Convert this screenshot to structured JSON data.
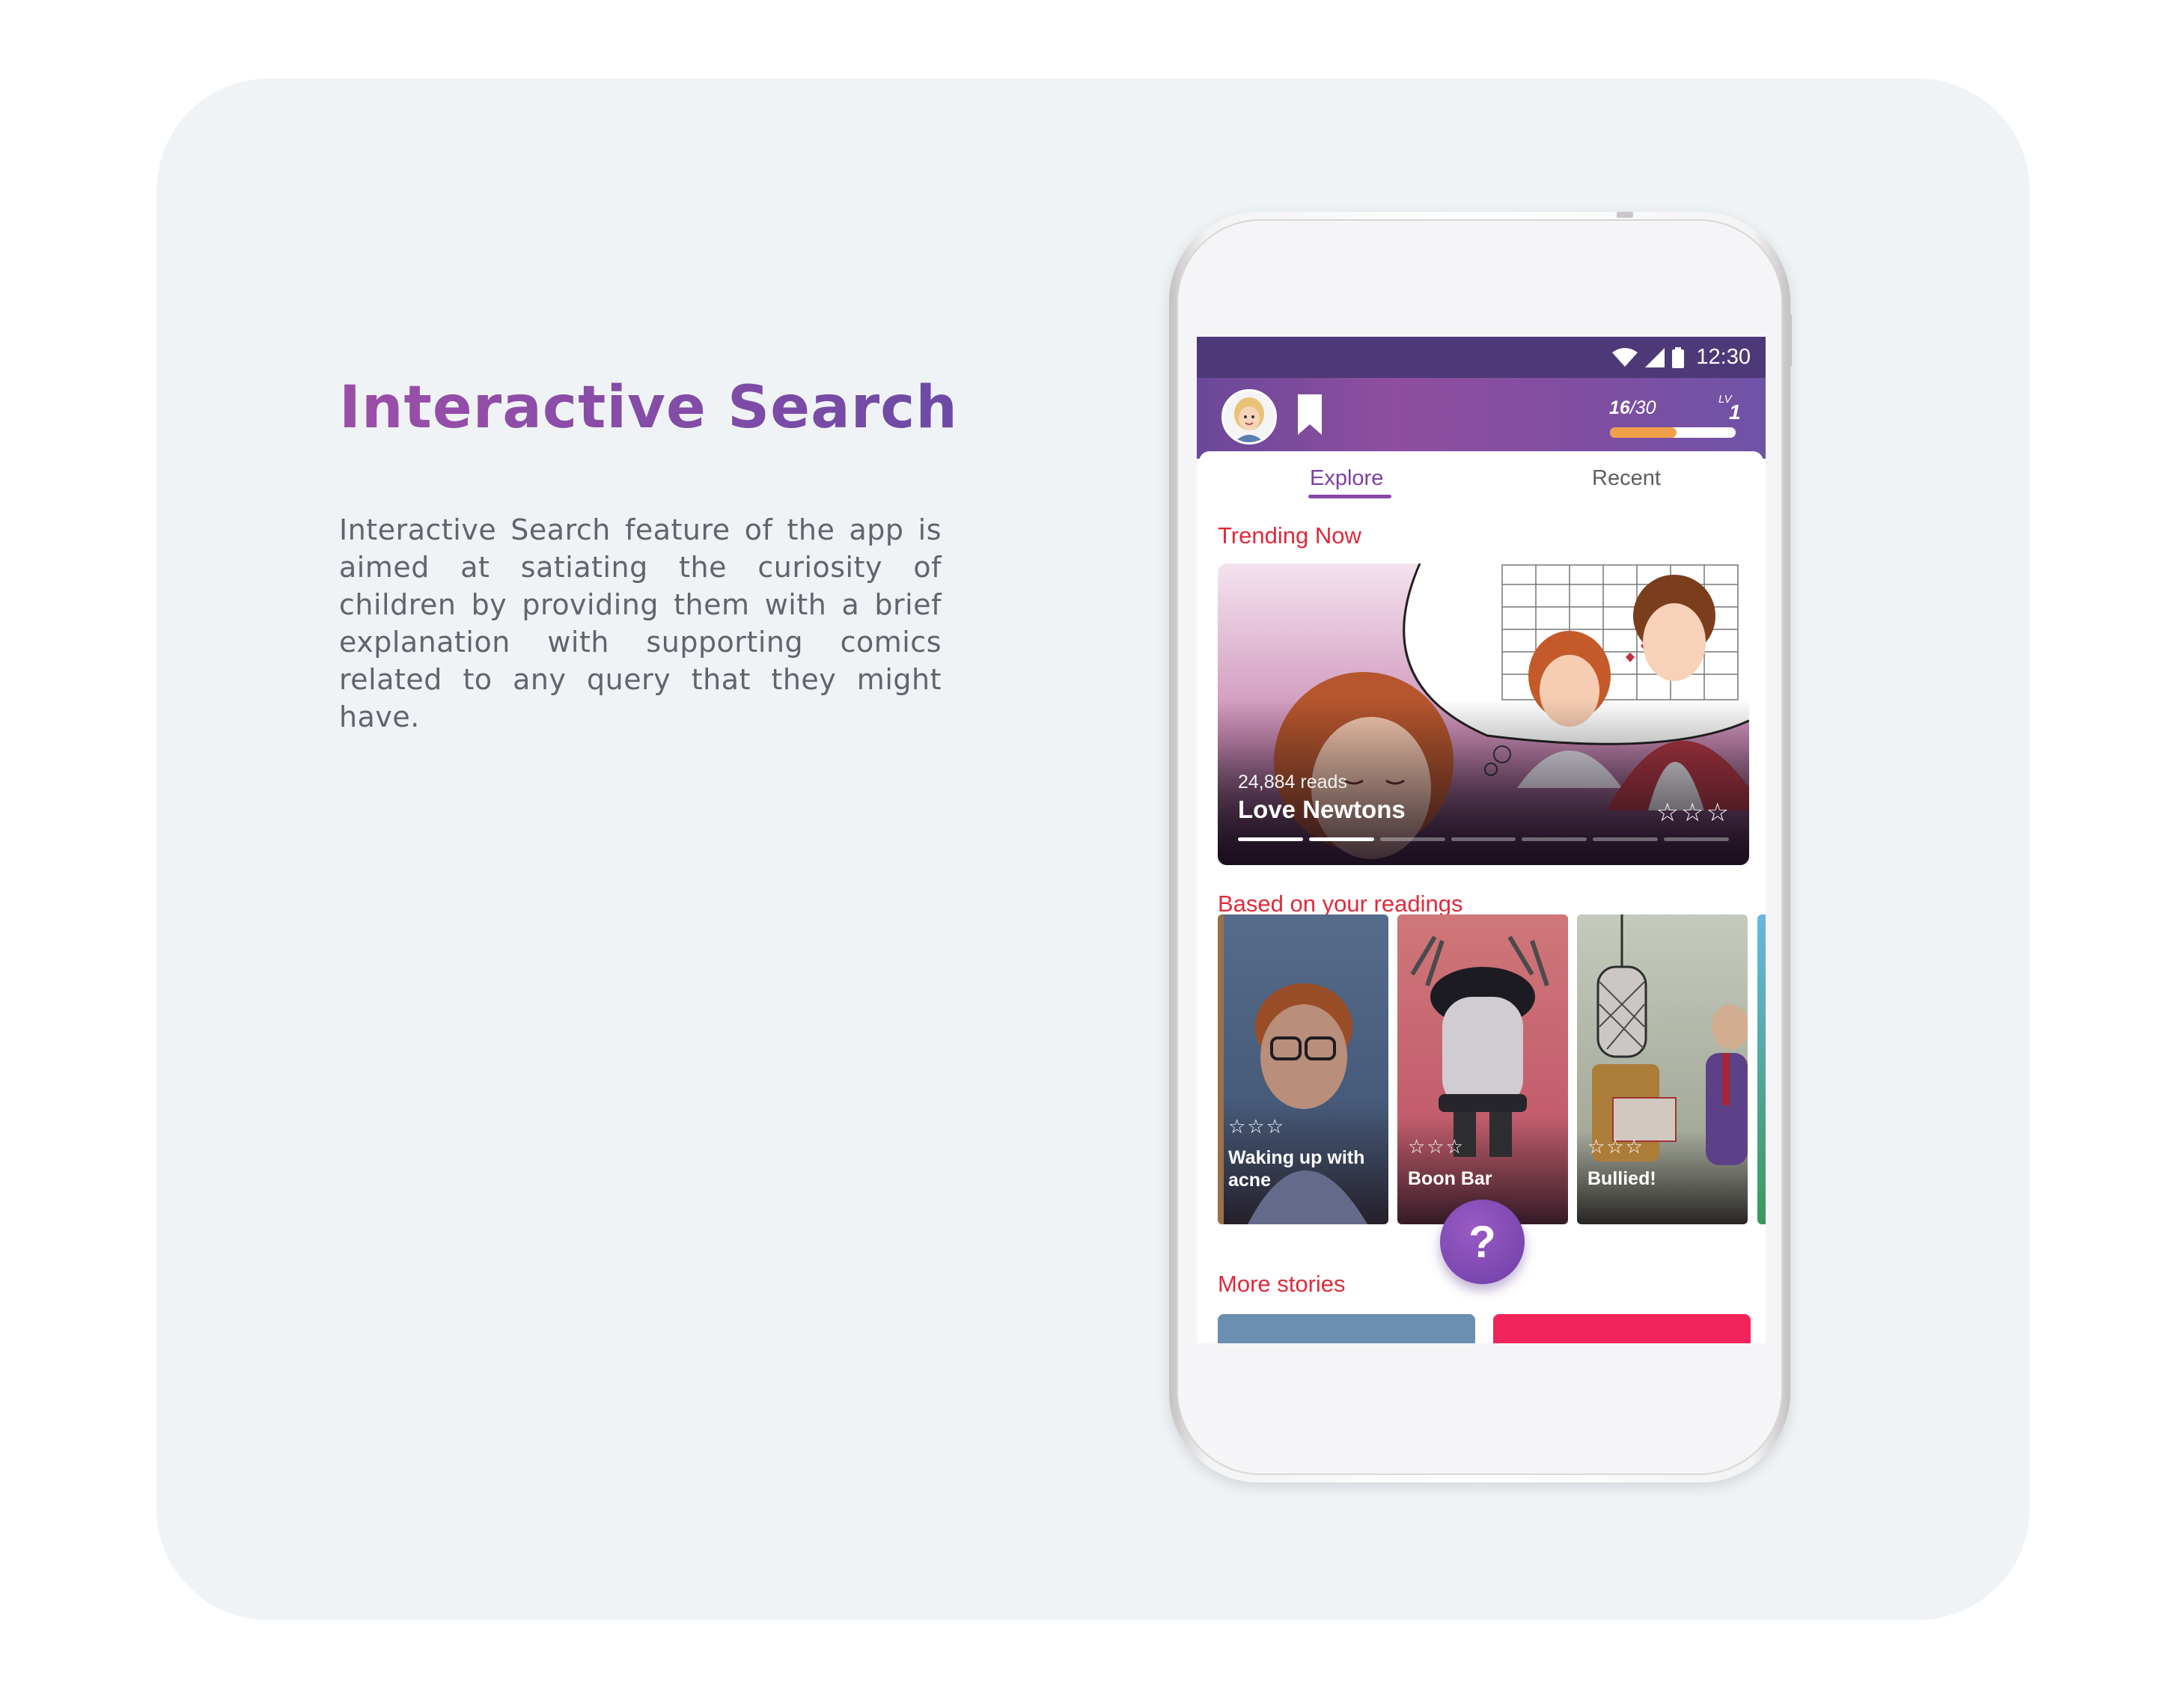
{
  "page": {
    "title": "Interactive Search",
    "description": "Interactive Search feature of the app is aimed at satiating the curiosity of children by providing them with a brief explanation with supporting comics related to any query that they might have."
  },
  "status_bar": {
    "time": "12:30",
    "icons": [
      "wifi-icon",
      "cellular-signal-icon",
      "battery-icon"
    ]
  },
  "header": {
    "avatar_icon": "user-avatar",
    "bookmark_icon": "bookmark-icon",
    "xp_current": "16",
    "xp_total": "/30",
    "xp_progress": 0.53,
    "level_label": "LV",
    "level_value": "1"
  },
  "tabs": [
    {
      "label": "Explore",
      "active": true
    },
    {
      "label": "Recent",
      "active": false
    }
  ],
  "trending": {
    "section_title": "Trending Now",
    "reads": "24,884 reads",
    "title": "Love Newtons",
    "stars": "☆☆☆",
    "carousel_count": 7,
    "carousel_active": 1
  },
  "based_on": {
    "section_title": "Based on your readings",
    "items": [
      {
        "title": "Waking up with acne",
        "stars": "☆☆☆"
      },
      {
        "title": "Boon Bar",
        "stars": "☆☆☆"
      },
      {
        "title": "Bullied!",
        "stars": "☆☆☆"
      }
    ]
  },
  "more_stories": {
    "section_title": "More stories"
  },
  "fab": {
    "label": "?",
    "icon": "question-icon"
  },
  "colors": {
    "accent_purple": "#7d3fa0",
    "section_red": "#e0293b",
    "status_bar": "#4e3978",
    "xp_fill": "#f1a04a"
  }
}
